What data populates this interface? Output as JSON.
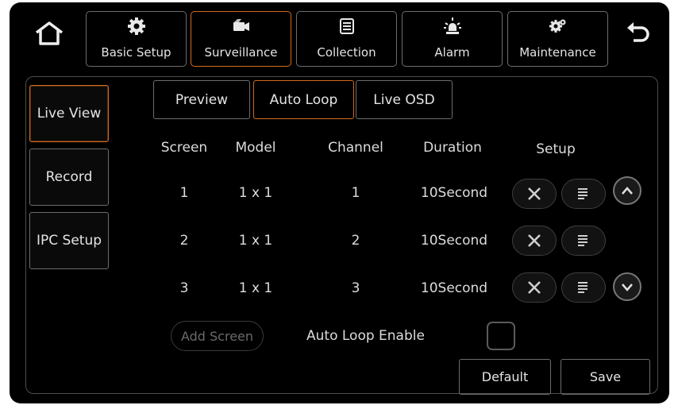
{
  "topbar": {
    "tabs": [
      {
        "label": "Basic Setup",
        "icon": "gear-icon"
      },
      {
        "label": "Surveillance",
        "icon": "camera-icon"
      },
      {
        "label": "Collection",
        "icon": "document-icon"
      },
      {
        "label": "Alarm",
        "icon": "alarm-light-icon"
      },
      {
        "label": "Maintenance",
        "icon": "gears-icon"
      }
    ],
    "active_tab": "Surveillance"
  },
  "sidebar": {
    "items": [
      {
        "label": "Live View"
      },
      {
        "label": "Record"
      },
      {
        "label": "IPC Setup"
      }
    ],
    "active_item": "Live View"
  },
  "subtabs": {
    "items": [
      {
        "label": "Preview"
      },
      {
        "label": "Auto Loop"
      },
      {
        "label": "Live OSD"
      }
    ],
    "active": "Auto Loop"
  },
  "table": {
    "headers": [
      "Screen",
      "Model",
      "Channel",
      "Duration",
      "Setup"
    ],
    "rows": [
      {
        "screen": "1",
        "model": "1 x 1",
        "channel": "1",
        "duration": "10Second"
      },
      {
        "screen": "2",
        "model": "1 x 1",
        "channel": "2",
        "duration": "10Second"
      },
      {
        "screen": "3",
        "model": "1 x 1",
        "channel": "3",
        "duration": "10Second"
      }
    ]
  },
  "controls": {
    "add_screen": "Add Screen",
    "auto_loop_label": "Auto Loop Enable",
    "auto_loop_enabled": false,
    "default": "Default",
    "save": "Save"
  },
  "colors": {
    "accent": "#d46a1e",
    "background": "#000000"
  }
}
